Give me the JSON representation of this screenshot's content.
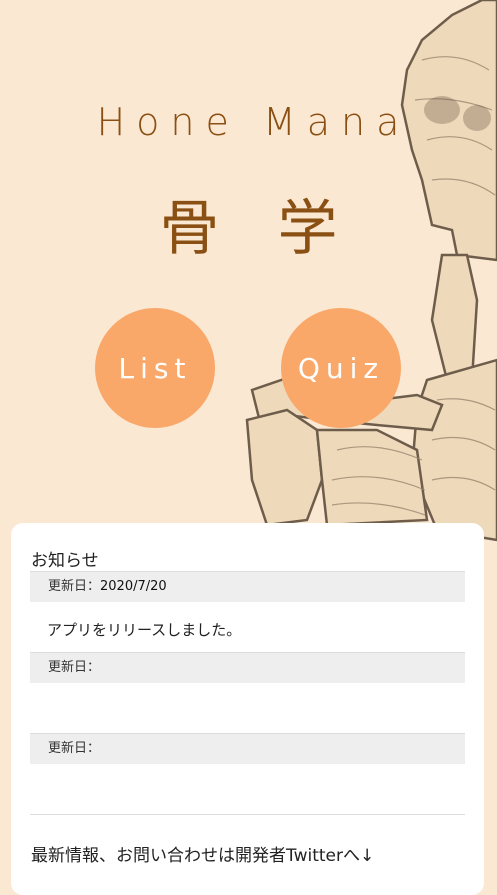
{
  "app": {
    "title_en": "Hone Mana",
    "title_jp": "骨学"
  },
  "buttons": {
    "list_label": "List",
    "quiz_label": "Quiz"
  },
  "news": {
    "heading": "お知らせ",
    "items": [
      {
        "label": "更新日：",
        "date": "2020/7/20",
        "body": "アプリをリリースしました。"
      },
      {
        "label": "更新日：",
        "date": "",
        "body": ""
      },
      {
        "label": "更新日：",
        "date": "",
        "body": ""
      }
    ],
    "footer": "最新情報、お問い合わせは開発者Twitterへ↓"
  },
  "colors": {
    "background": "#fbe8d3",
    "accent": "#f9a86a",
    "title": "#8a4f12"
  }
}
